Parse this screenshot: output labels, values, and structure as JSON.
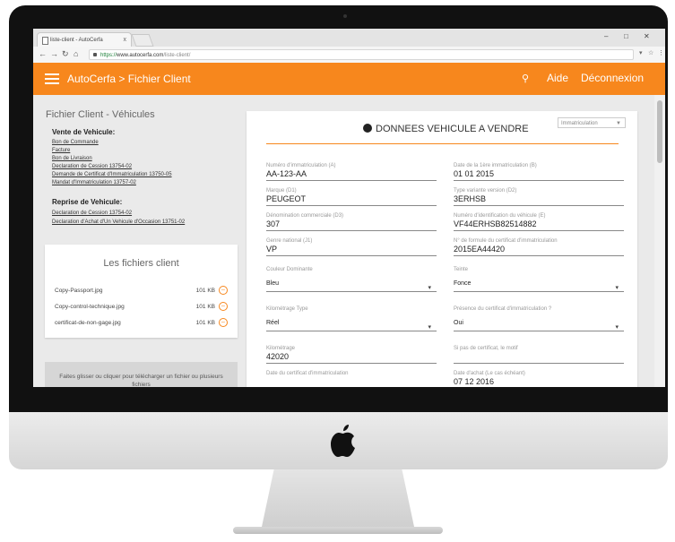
{
  "browser": {
    "tab_title": "liste-client - AutoCerfa",
    "tab_close": "x",
    "url_scheme": "https://",
    "url_host": "www.autocerfa.com",
    "url_path": "/liste-client/",
    "win_min": "–",
    "win_max": "□",
    "win_close": "✕"
  },
  "header": {
    "brand": "AutoCerfa > Fichier Client",
    "search_glyph": "⚲",
    "nav_aide": "Aide",
    "nav_deconnexion": "Déconnexion",
    "accent_color": "#f7871d"
  },
  "sidebar": {
    "title": "Fichier Client - Véhicules",
    "vente_heading": "Vente de Vehicule:",
    "vente_links": [
      "Bon de Commande",
      "Facture",
      "Bon de Livraison",
      "Declaration de Cession 13754-02",
      "Demande de Certificat d'Immatriculation 13750-05",
      "Mandat d'Immatriculation 13757-02"
    ],
    "reprise_heading": "Reprise de Vehicule:",
    "reprise_links": [
      "Declaration de Cession 13754-02",
      "Declaration d'Achat d'Un Vehicule d'Occasion 13751-02"
    ],
    "files_title": "Les fichiers client",
    "files": [
      {
        "name": "Copy-Passport.jpg",
        "size": "101 KB"
      },
      {
        "name": "Copy-control-technique.jpg",
        "size": "101 KB"
      },
      {
        "name": "certificat-de-non-gage.jpg",
        "size": "101 KB"
      }
    ],
    "dropzone": "Faites glisser ou cliquer pour télécharger un fichier ou plusieurs fichiers"
  },
  "card": {
    "title": "DONNEES VEHICULE A VENDRE",
    "select_value": "Immatriculation",
    "fields": [
      {
        "label": "Numéro d'immatriculation (A)",
        "value": "AA-123-AA"
      },
      {
        "label": "Date de la 1ère immatriculation (B)",
        "value": "01 01 2015"
      },
      {
        "label": "Marque (D1)",
        "value": "PEUGEOT"
      },
      {
        "label": "Type variante version (D2)",
        "value": "3ERHSB"
      },
      {
        "label": "Dénomination commerciale (D3)",
        "value": "307"
      },
      {
        "label": "Numéro d'identification du véhicule (E)",
        "value": "VF44ERHSB82514882"
      },
      {
        "label": "Genre national (J1)",
        "value": "VP"
      },
      {
        "label": "N° de formule du certificat d'immatriculation",
        "value": "2015EA44420"
      },
      {
        "label": "Couleur Dominante",
        "value": "Bleu"
      },
      {
        "label": "Teinte",
        "value": "Fonce"
      },
      {
        "label": "Kilométrage Type",
        "value": "Réel"
      },
      {
        "label": "Présence du certificat d'immatriculation ?",
        "value": "Oui"
      },
      {
        "label": "Kilométrage",
        "value": "42020"
      },
      {
        "label": "Si pas de certificat, le motif",
        "value": ""
      },
      {
        "label": "Date du certificat d'immatriculation",
        "value": ""
      },
      {
        "label": "Date d'achat (Le cas échéant)",
        "value": "07 12 2016"
      }
    ]
  }
}
